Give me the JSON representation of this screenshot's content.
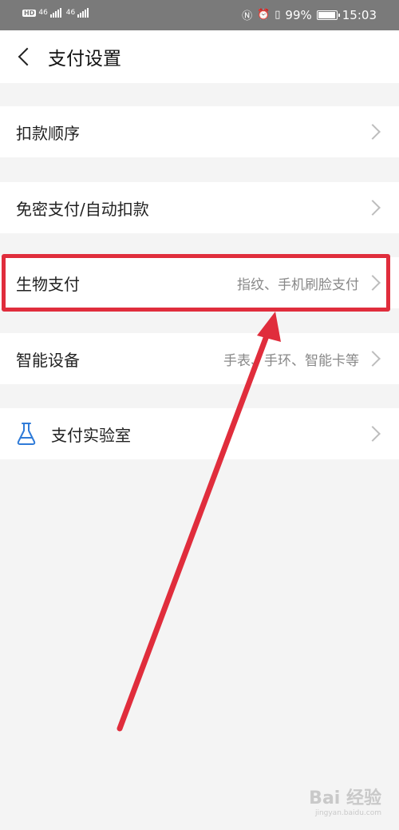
{
  "status_bar": {
    "hd_badge": "HD",
    "network_left": "46",
    "network_right": "46",
    "battery": "99%",
    "time": "15:03"
  },
  "header": {
    "title": "支付设置"
  },
  "list": {
    "items": [
      {
        "label": "扣款顺序",
        "value": ""
      },
      {
        "label": "免密支付/自动扣款",
        "value": ""
      },
      {
        "label": "生物支付",
        "value": "指纹、手机刷脸支付"
      },
      {
        "label": "智能设备",
        "value": "手表、手环、智能卡等"
      },
      {
        "label": "支付实验室",
        "value": ""
      }
    ]
  },
  "watermark": {
    "text": "Bai 经验",
    "url": "jingyan.baidu.com"
  },
  "colors": {
    "status_bar": "#7a7a7a",
    "highlight": "#e02d3c",
    "flask_icon": "#2f7bd8"
  }
}
